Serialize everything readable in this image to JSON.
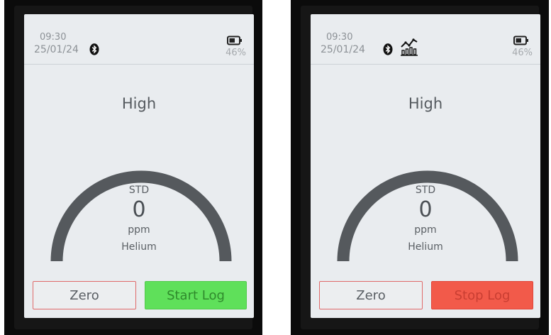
{
  "screens": [
    {
      "time": "09:30",
      "date": "25/01/24",
      "battery": "46%",
      "mode": "High",
      "reading": {
        "label": "STD",
        "value": "0",
        "unit": "ppm",
        "gas": "Helium"
      },
      "buttons": {
        "zero": "Zero",
        "log": "Start Log"
      },
      "log_button_color": "#5fe05a",
      "icons": [
        "bluetooth-icon",
        "battery-icon"
      ],
      "logging_active": false
    },
    {
      "time": "09:30",
      "date": "25/01/24",
      "battery": "46%",
      "mode": "High",
      "reading": {
        "label": "STD",
        "value": "0",
        "unit": "ppm",
        "gas": "Helium"
      },
      "buttons": {
        "zero": "Zero",
        "log": "Stop Log"
      },
      "log_button_color": "#f25a4a",
      "icons": [
        "bluetooth-icon",
        "log-chart-icon",
        "battery-icon"
      ],
      "logging_active": true
    }
  ],
  "colors": {
    "screen_bg": "#e9ecef",
    "gauge_arc": "#55595d",
    "zero_border": "#e06a6a"
  }
}
